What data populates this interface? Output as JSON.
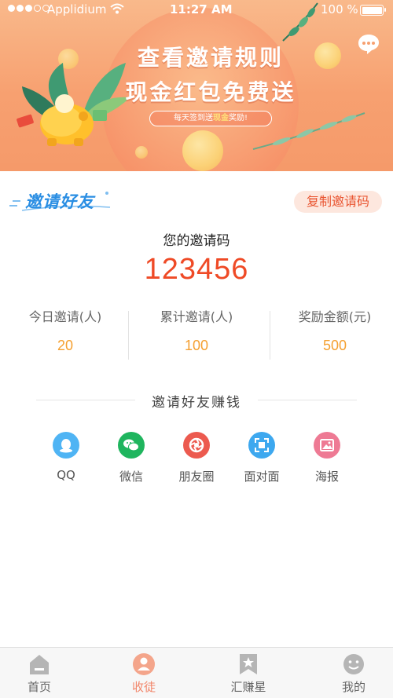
{
  "status_bar": {
    "carrier": "Applidium",
    "time": "11:27 AM",
    "battery": "100 %"
  },
  "banner": {
    "title_line1": "查看邀请规则",
    "title_line2": "现金红包免费送",
    "pill_prefix": "每天签到送",
    "pill_highlight": "现金",
    "pill_suffix": "奖励!",
    "chat_icon": "chat-bubble-icon"
  },
  "invite": {
    "logo_text": "邀请好友",
    "copy_button": "复制邀请码",
    "code_label": "您的邀请码",
    "code_value": "123456"
  },
  "stats": [
    {
      "label": "今日邀请(人)",
      "value": "20"
    },
    {
      "label": "累计邀请(人)",
      "value": "100"
    },
    {
      "label": "奖励金额(元)",
      "value": "500"
    }
  ],
  "section_title": "邀请好友赚钱",
  "share": [
    {
      "label": "QQ",
      "icon": "qq-icon",
      "color": "#4fb4f4"
    },
    {
      "label": "微信",
      "icon": "wechat-icon",
      "color": "#1fb55e"
    },
    {
      "label": "朋友圈",
      "icon": "moments-icon",
      "color": "#ec5a4f"
    },
    {
      "label": "面对面",
      "icon": "scan-icon",
      "color": "#3da8ef"
    },
    {
      "label": "海报",
      "icon": "poster-icon",
      "color": "#ee7a94"
    }
  ],
  "tabs": [
    {
      "label": "首页",
      "icon": "home-icon",
      "active": false
    },
    {
      "label": "收徒",
      "icon": "apprentice-icon",
      "active": true
    },
    {
      "label": "汇赚星",
      "icon": "star-icon",
      "active": false
    },
    {
      "label": "我的",
      "icon": "profile-icon",
      "active": false
    }
  ],
  "colors": {
    "accent": "#ef4a26",
    "stat_value": "#f5a031",
    "tab_active": "#f2866a",
    "logo_blue": "#2a8ee3"
  }
}
